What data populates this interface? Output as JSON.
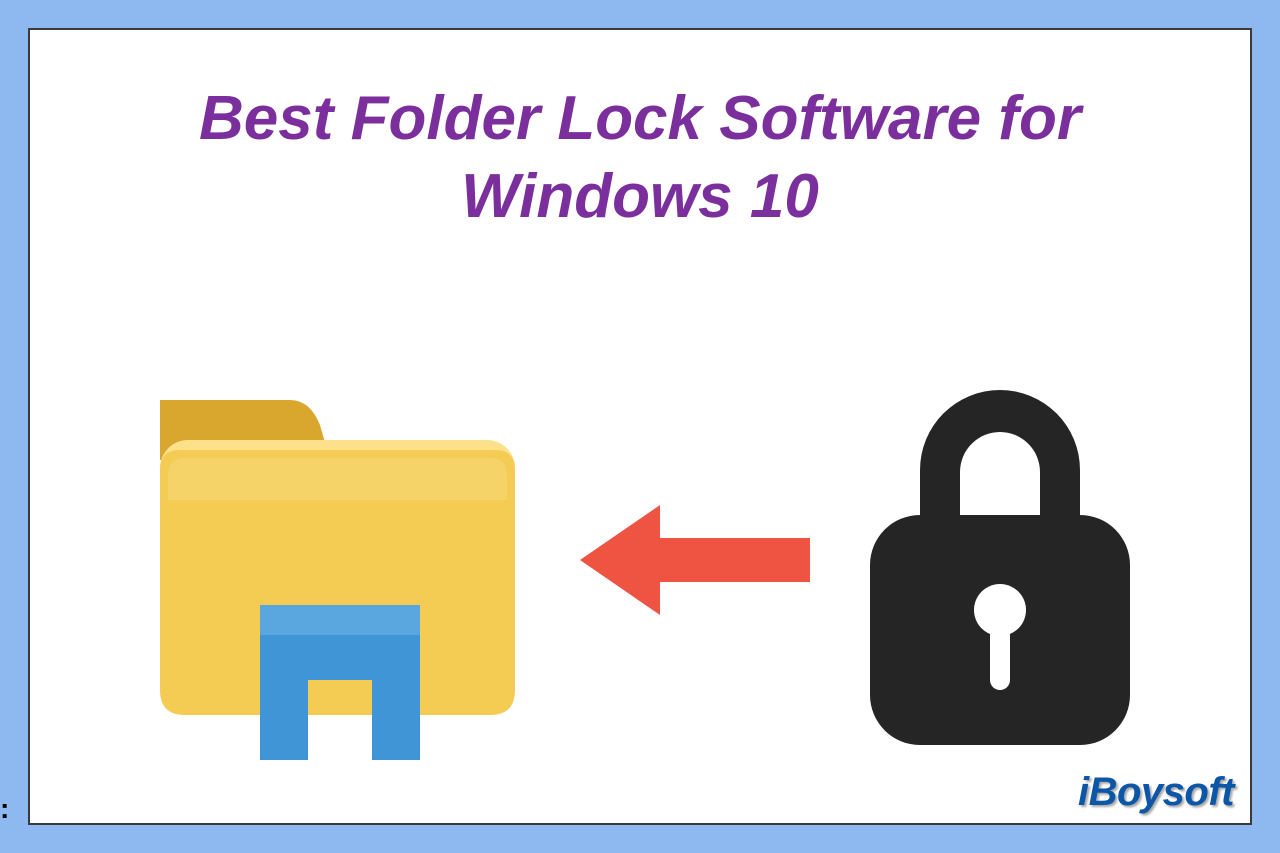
{
  "title": "Best Folder Lock Software for Windows 10",
  "brand": "iBoysoft",
  "colors": {
    "border": "#8db8f0",
    "title": "#7b2f9d",
    "arrow": "#ef5342",
    "lock": "#252525",
    "folder_body": "#f4cb53",
    "folder_tab": "#d9a72e",
    "folder_clip": "#3f95d6",
    "brand": "#0b56a6"
  },
  "icons": {
    "folder": "folder-icon",
    "lock": "lock-icon",
    "arrow": "arrow-left-icon"
  }
}
